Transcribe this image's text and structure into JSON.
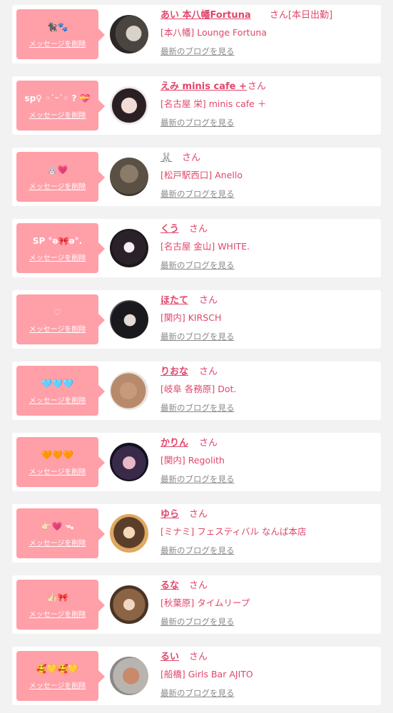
{
  "items": [
    {
      "message": "🐈‍⬛🐾",
      "delete_label": "メッセージを削除",
      "name": "あい 本八幡Fortuna",
      "honorific": "さん[本日出勤]",
      "shop": "[本八幡] Lounge Fortuna",
      "blog_link": "最新のブログを見る"
    },
    {
      "message": "sp♀ ◦˙ᵕ˙◦ ? 💝",
      "delete_label": "メッセージを削除",
      "name": "えみ minis cafe +",
      "honorific": "さん",
      "shop": "[名古屋 栄] minis cafe ＋",
      "blog_link": "最新のブログを見る"
    },
    {
      "message": "🐰💗",
      "delete_label": "メッセージを削除",
      "name": "🐰",
      "honorific": "さん",
      "shop": "[松戸駅西口] Anello",
      "blog_link": "最新のブログを見る"
    },
    {
      "message": "SP °ə🎀ə°.",
      "delete_label": "メッセージを削除",
      "name": "くう",
      "honorific": "さん",
      "shop": "[名古屋 金山] WHITE.",
      "blog_link": "最新のブログを見る"
    },
    {
      "message": "♡",
      "delete_label": "メッセージを削除",
      "name": "ほたて",
      "honorific": "さん",
      "shop": "[関内] KIRSCH",
      "blog_link": "最新のブログを見る"
    },
    {
      "message": "🩵🩵🩵",
      "delete_label": "メッセージを削除",
      "name": "りおな",
      "honorific": "さん",
      "shop": "[岐阜 各務原] Dot.",
      "blog_link": "最新のブログを見る"
    },
    {
      "message": "🧡🧡🧡",
      "delete_label": "メッセージを削除",
      "name": "かりん",
      "honorific": "さん",
      "shop": "[関内] Regolith",
      "blog_link": "最新のブログを見る"
    },
    {
      "message": "👉🏻💗 ᯓ",
      "delete_label": "メッセージを削除",
      "name": "ゆら",
      "honorific": "さん",
      "shop": "[ミナミ] フェスティバル なんば本店",
      "blog_link": "最新のブログを見る"
    },
    {
      "message": "👍🏻🎀",
      "delete_label": "メッセージを削除",
      "name": "るな",
      "honorific": "さん",
      "shop": "[秋葉原] タイムリープ",
      "blog_link": "最新のブログを見る"
    },
    {
      "message": "🥰💛🥰💛",
      "delete_label": "メッセージを削除",
      "name": "るい",
      "honorific": "さん",
      "shop": "[船橋] Girls Bar AJITO",
      "blog_link": "最新のブログを見る"
    }
  ]
}
